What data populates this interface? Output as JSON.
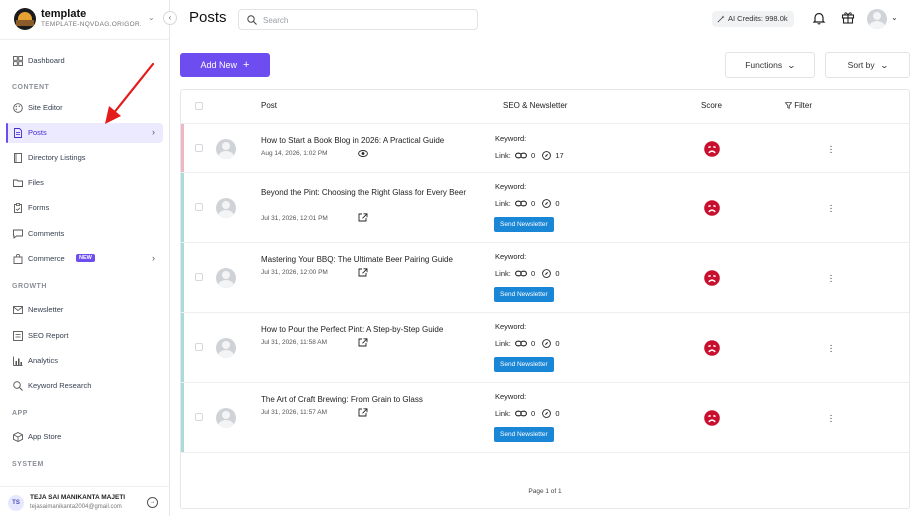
{
  "brand": {
    "name": "template",
    "subtitle": "TEMPLATE-NQVDAG.ORIGOR..."
  },
  "sidebar": {
    "sections": {
      "content": "CONTENT",
      "growth": "GROWTH",
      "app": "APP",
      "system": "SYSTEM"
    },
    "items": {
      "dashboard": "Dashboard",
      "site_editor": "Site Editor",
      "posts": "Posts",
      "directory": "Directory Listings",
      "files": "Files",
      "forms": "Forms",
      "comments": "Comments",
      "commerce": "Commerce",
      "commerce_badge": "NEW",
      "newsletter": "Newsletter",
      "seo_report": "SEO Report",
      "analytics": "Analytics",
      "keyword_research": "Keyword Research",
      "app_store": "App Store"
    }
  },
  "user": {
    "initials": "TS",
    "name": "TEJA SAI MANIKANTA MAJETI",
    "email": "tejasaimanikanta2004@gmail.com"
  },
  "header": {
    "title": "Posts",
    "search_placeholder": "Search",
    "ai_credits": "AI Credits: 998.0k"
  },
  "toolbar": {
    "add_new": "Add New",
    "add_icon": "+",
    "functions": "Functions",
    "sort_by": "Sort by"
  },
  "table": {
    "columns": {
      "post": "Post",
      "seo": "SEO & Newsletter",
      "score": "Score",
      "filter": "Filter"
    },
    "rows": [
      {
        "title": "How to Start a Book Blog in 2026: A Practical Guide",
        "date": "Aug 14, 2026, 1:02 PM",
        "action_icon": "eye-icon",
        "keyword": "Keyword:",
        "link_label": "Link:",
        "links": "0",
        "clicks": "17",
        "newsletter": "",
        "stripe": "#f0b6c2"
      },
      {
        "title": "Beyond the Pint: Choosing the Right Glass for Every Beer",
        "date": "Jul 31, 2026, 12:01 PM",
        "action_icon": "external-link-icon",
        "keyword": "Keyword:",
        "link_label": "Link:",
        "links": "0",
        "clicks": "0",
        "newsletter": "Send Newsletter",
        "stripe": "#a9dcd8"
      },
      {
        "title": "Mastering Your BBQ: The Ultimate Beer Pairing Guide",
        "date": "Jul 31, 2026, 12:00 PM",
        "action_icon": "external-link-icon",
        "keyword": "Keyword:",
        "link_label": "Link:",
        "links": "0",
        "clicks": "0",
        "newsletter": "Send Newsletter",
        "stripe": "#a9dcd8"
      },
      {
        "title": "How to Pour the Perfect Pint: A Step-by-Step Guide",
        "date": "Jul 31, 2026, 11:58 AM",
        "action_icon": "external-link-icon",
        "keyword": "Keyword:",
        "link_label": "Link:",
        "links": "0",
        "clicks": "0",
        "newsletter": "Send Newsletter",
        "stripe": "#a9dcd8"
      },
      {
        "title": "The Art of Craft Brewing: From Grain to Glass",
        "date": "Jul 31, 2026, 11:57 AM",
        "action_icon": "external-link-icon",
        "keyword": "Keyword:",
        "link_label": "Link:",
        "links": "0",
        "clicks": "0",
        "newsletter": "Send Newsletter",
        "stripe": "#a9dcd8"
      }
    ],
    "pagination": "Page 1 of 1"
  },
  "colors": {
    "accent": "#6d4cf0",
    "newsletter_button": "#1a86d6",
    "score_bad": "#c8102e",
    "annotation_arrow": "#e31b1b"
  }
}
